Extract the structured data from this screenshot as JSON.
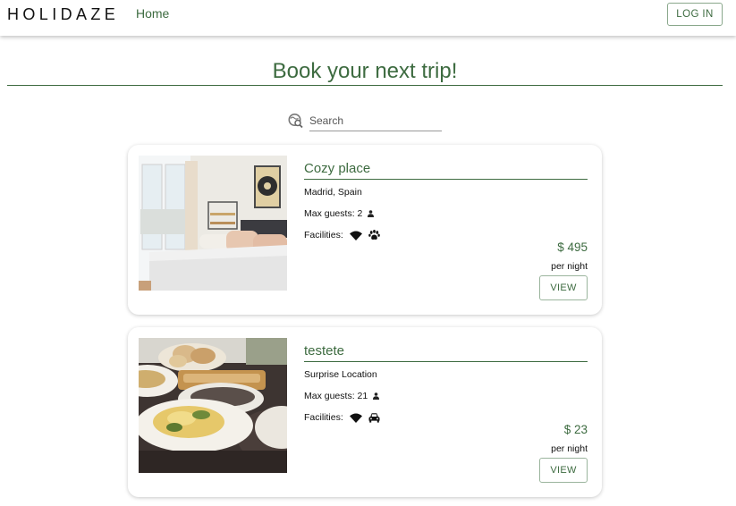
{
  "header": {
    "brand": "HOLIDAZE",
    "nav_home": "Home",
    "login_label": "LOG IN"
  },
  "main": {
    "title": "Book your next trip!",
    "search": {
      "placeholder": "Search",
      "value": ""
    },
    "cards": [
      {
        "title": "Cozy place",
        "location": "Madrid, Spain",
        "guests_label": "Max guests: 2",
        "facilities_label": "Facilities:",
        "facility_icons": [
          "wifi-icon",
          "paw-icon"
        ],
        "price": "$ 495",
        "per_night": "per night",
        "view_label": "VIEW",
        "image": "bedroom-photo"
      },
      {
        "title": "testete",
        "location": "Surprise Location",
        "guests_label": "Max guests: 21",
        "facilities_label": "Facilities:",
        "facility_icons": [
          "wifi-icon",
          "car-icon"
        ],
        "price": "$ 23",
        "per_night": "per night",
        "view_label": "VIEW",
        "image": "breakfast-table-photo"
      }
    ]
  },
  "colors": {
    "accent": "#3d6b40",
    "button_border": "#8aa88c",
    "text": "#111111",
    "background": "#ffffff"
  }
}
